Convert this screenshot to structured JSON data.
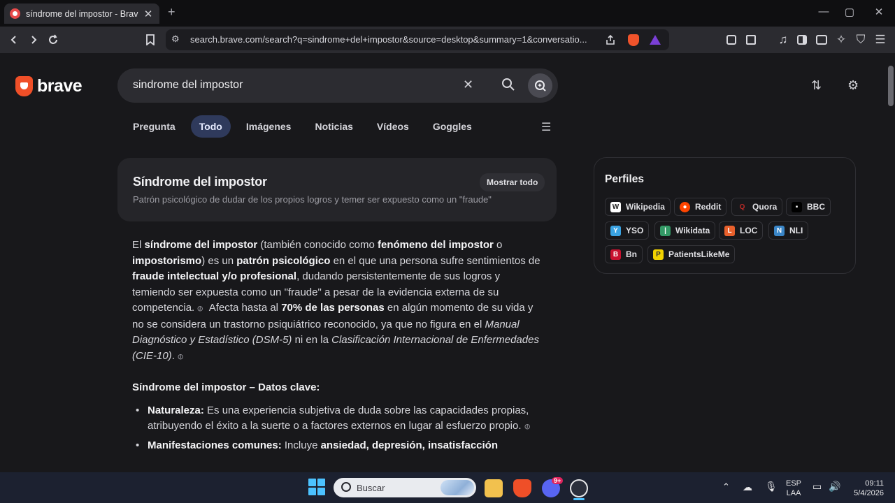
{
  "browser": {
    "tab_title": "síndrome del impostor - Brave Se",
    "tab_close": "✕",
    "new_tab": "+",
    "window_controls": [
      "—",
      "▢",
      "✕"
    ],
    "url": "search.brave.com/search?q=sindrome+del+impostor&source=desktop&summary=1&conversatio...",
    "accent_color": "#f0532b"
  },
  "search": {
    "logo_text": "brave",
    "query": "sindrome del impostor",
    "clear_icon": "✕"
  },
  "nav": {
    "tabs": [
      "Pregunta",
      "Todo",
      "Imágenes",
      "Noticias",
      "Vídeos",
      "Goggles"
    ],
    "active_tab": "Todo"
  },
  "infobox": {
    "title": "Síndrome del impostor",
    "subtitle": "Patrón psicológico de dudar de los propios logros y temer ser expuesto como un \"fraude\"",
    "button": "Mostrar todo"
  },
  "summary": {
    "p1": {
      "t1": "El ",
      "b1": "síndrome del impostor",
      "t2": " (también conocido como ",
      "b2": "fenómeno del impostor",
      "t3": " o ",
      "b3": "impostorismo",
      "t4": ") es un ",
      "b4": "patrón psicológico",
      "t5": " en el que una persona sufre sentimientos de ",
      "b5": "fraude intelectual y/o profesional",
      "t6": ", dudando persistentemente de sus logros y temiendo ser expuesta como un \"fraude\" a pesar de la evidencia externa de su competencia.",
      "t7": " Afecta hasta al ",
      "b6": "70% de las personas",
      "t8": " en algún momento de su vida y no se considera un trastorno psiquiátrico reconocido, ya que no figura en el ",
      "i1": "Manual Diagnóstico y Estadístico (DSM-5)",
      "t9": " ni en la ",
      "i2": "Clasificación Internacional de Enfermedades (CIE-10)",
      "t10": "."
    },
    "heading": "Síndrome del impostor – Datos clave:",
    "items": [
      {
        "label": "Naturaleza:",
        "text": " Es una experiencia subjetiva de duda sobre las capacidades propias, atribuyendo el éxito a la suerte o a factores externos en lugar al esfuerzo propio."
      },
      {
        "label": "Manifestaciones comunes:",
        "text": " Incluye ",
        "bold": "ansiedad, depresión, insatisfacción"
      }
    ]
  },
  "profiles": {
    "title": "Perfiles",
    "items": [
      {
        "label": "Wikipedia",
        "color": "#ffffff",
        "glyph": "W"
      },
      {
        "label": "Reddit",
        "color": "#ff4500",
        "glyph": "●"
      },
      {
        "label": "Quora",
        "color": "#b92b27",
        "glyph": "Q"
      },
      {
        "label": "BBC",
        "color": "#000000",
        "glyph": "▪"
      },
      {
        "label": "YSO",
        "color": "#3aa3e3",
        "glyph": "Y"
      },
      {
        "label": "Wikidata",
        "color": "#339966",
        "glyph": "|"
      },
      {
        "label": "LOC",
        "color": "#e8602c",
        "glyph": "L"
      },
      {
        "label": "NLI",
        "color": "#3a86c8",
        "glyph": "N"
      },
      {
        "label": "Bn",
        "color": "#c8102e",
        "glyph": "B"
      },
      {
        "label": "PatientsLikeMe",
        "color": "#f2d200",
        "glyph": "P"
      }
    ]
  },
  "taskbar": {
    "search_placeholder": "Buscar",
    "discord_badge": "9+",
    "lang_top": "ESP",
    "lang_bottom": "LAA",
    "time": "09:11",
    "date": "5/4/2026"
  }
}
